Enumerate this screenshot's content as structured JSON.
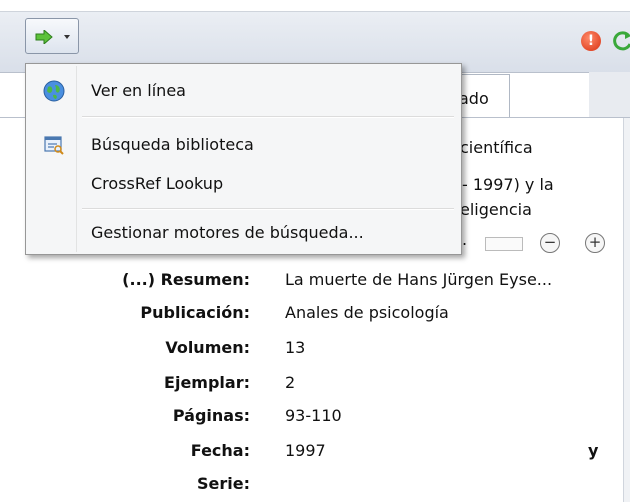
{
  "toolbar": {
    "locate_button": {
      "icon": "green-arrow-icon"
    },
    "alert_icon_glyph": "!",
    "sync_icon": "green-sync-icon"
  },
  "tab": {
    "partial_label": "ado"
  },
  "behind_menu": {
    "line1": "científica",
    "line2": "- 1997) y la",
    "line3": "eligencia",
    "zoom_minus": "−",
    "zoom_plus": "+"
  },
  "menu": {
    "items": [
      {
        "label": "Ver en línea",
        "icon": "globe-icon"
      },
      {
        "label": "Búsqueda biblioteca",
        "icon": "library-search-icon"
      },
      {
        "label": "CrossRef Lookup",
        "icon": ""
      },
      {
        "label": "Gestionar motores de búsqueda...",
        "icon": ""
      }
    ]
  },
  "fields": [
    {
      "label": "(...) Resumen:",
      "value": "La muerte de Hans Jürgen Eyse..."
    },
    {
      "label": "Publicación:",
      "value": "Anales de psicología"
    },
    {
      "label": "Volumen:",
      "value": "13"
    },
    {
      "label": "Ejemplar:",
      "value": "2"
    },
    {
      "label": "Páginas:",
      "value": "93-110"
    },
    {
      "label": "Fecha:",
      "value": "1997"
    },
    {
      "label": "Serie:",
      "value": ""
    }
  ],
  "date_suffix": "y",
  "colors": {
    "accent_green": "#3aa83a",
    "alert_red": "#d83010",
    "toolbar_bg": "#dde4ee"
  }
}
